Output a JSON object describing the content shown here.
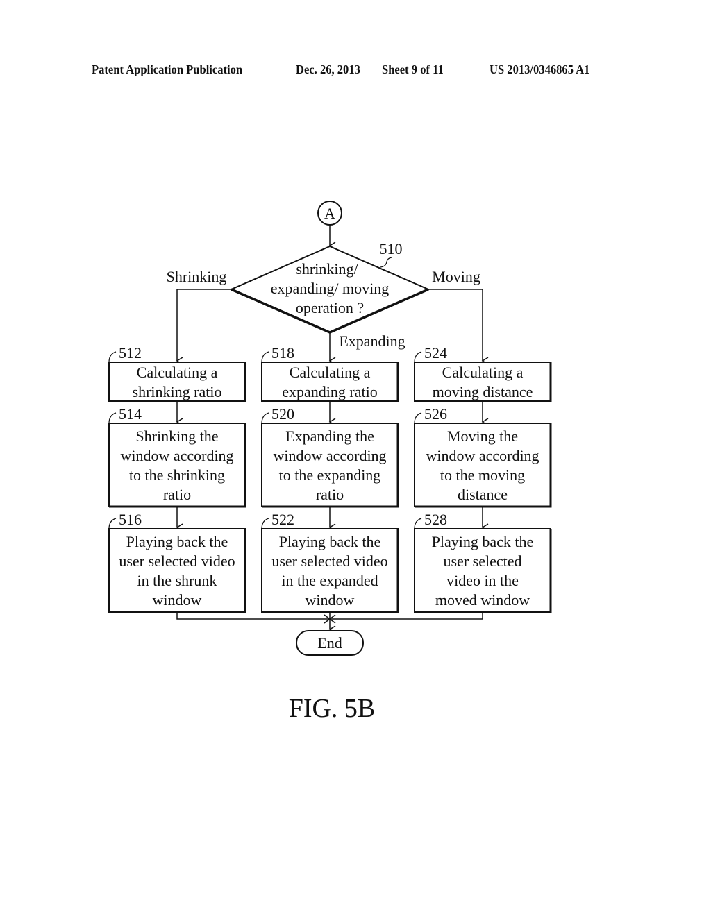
{
  "header": {
    "publication": "Patent Application Publication",
    "date_sheet": "Dec. 26, 2013",
    "sheet": "Sheet 9 of 11",
    "number": "US 2013/0346865 A1"
  },
  "connector_start": "A",
  "decision": {
    "ref": "510",
    "lines": [
      "shrinking/",
      "expanding/ moving",
      "operation ?"
    ],
    "branches": {
      "left": "Shrinking",
      "middle": "Expanding",
      "right": "Moving"
    }
  },
  "columns": [
    {
      "steps": [
        {
          "ref": "512",
          "lines": [
            "Calculating a",
            "shrinking ratio"
          ]
        },
        {
          "ref": "514",
          "lines": [
            "Shrinking the",
            "window according",
            "to the shrinking",
            "ratio"
          ]
        },
        {
          "ref": "516",
          "lines": [
            "Playing back the",
            "user selected video",
            "in the shrunk",
            "window"
          ]
        }
      ]
    },
    {
      "steps": [
        {
          "ref": "518",
          "lines": [
            "Calculating a",
            "expanding ratio"
          ]
        },
        {
          "ref": "520",
          "lines": [
            "Expanding the",
            "window according",
            "to the expanding",
            "ratio"
          ]
        },
        {
          "ref": "522",
          "lines": [
            "Playing back the",
            "user selected video",
            "in the expanded",
            "window"
          ]
        }
      ]
    },
    {
      "steps": [
        {
          "ref": "524",
          "lines": [
            "Calculating a",
            "moving distance"
          ]
        },
        {
          "ref": "526",
          "lines": [
            "Moving the",
            "window according",
            "to the moving",
            "distance"
          ]
        },
        {
          "ref": "528",
          "lines": [
            "Playing back the",
            "user selected",
            "video in the",
            "moved window"
          ]
        }
      ]
    }
  ],
  "terminal_end": "End",
  "figure_label": "FIG.  5B"
}
